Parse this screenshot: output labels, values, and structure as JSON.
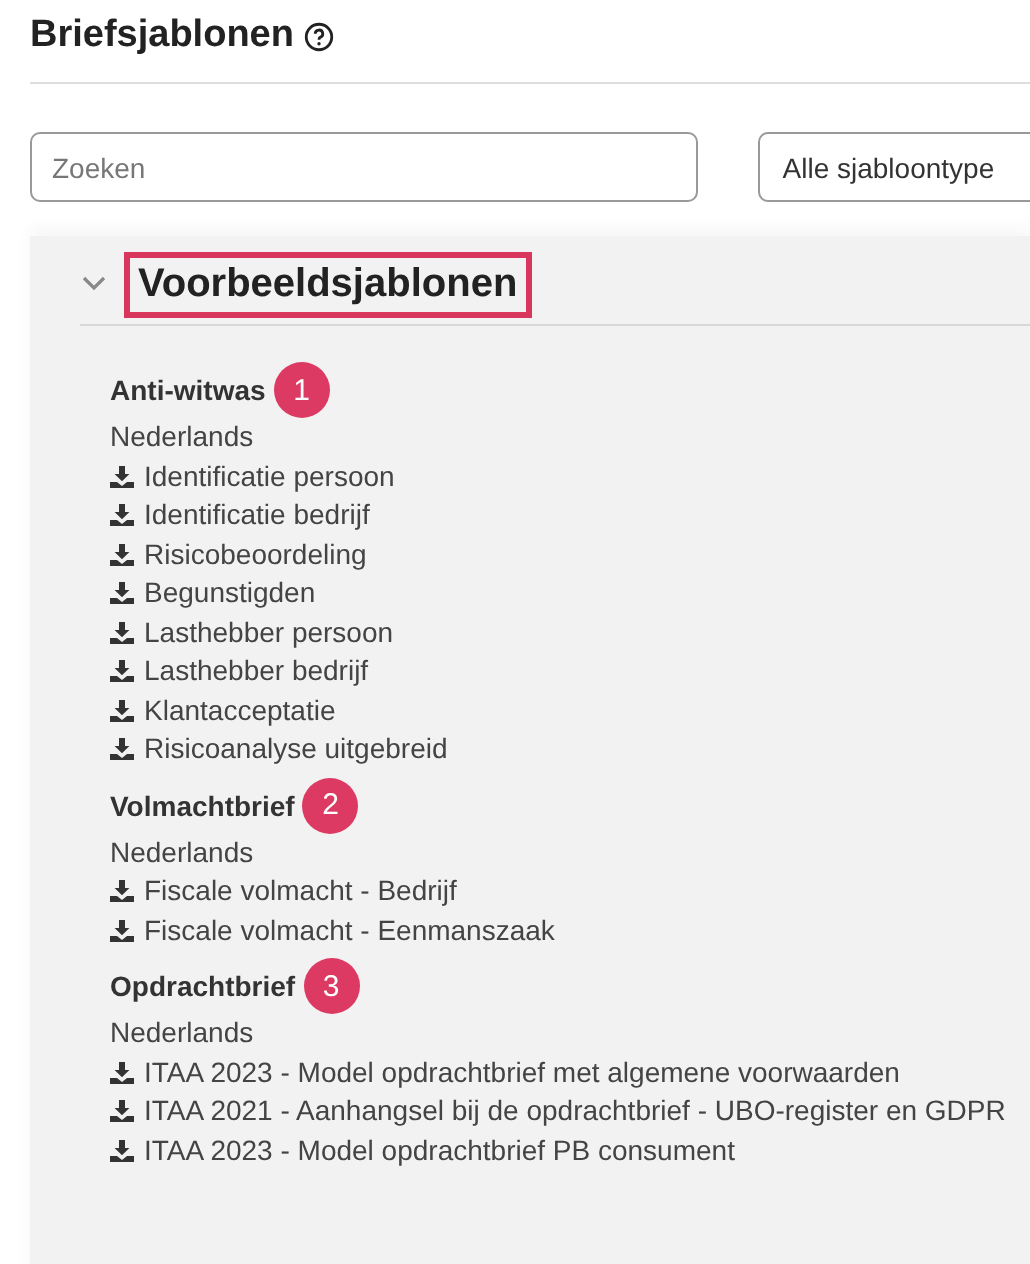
{
  "page": {
    "title": "Briefsjablonen"
  },
  "search": {
    "placeholder": "Zoeken"
  },
  "type_filter": {
    "value": "Alle sjabloontype"
  },
  "section": {
    "title": "Voorbeeldsjablonen",
    "expanded": true,
    "groups": [
      {
        "title": "Anti-witwas",
        "badge": "1",
        "language": "Nederlands",
        "templates": [
          "Identificatie persoon",
          "Identificatie bedrijf",
          "Risicobeoordeling",
          "Begunstigden",
          "Lasthebber persoon",
          "Lasthebber bedrijf",
          "Klantacceptatie",
          "Risicoanalyse uitgebreid"
        ]
      },
      {
        "title": "Volmachtbrief",
        "badge": "2",
        "language": "Nederlands",
        "templates": [
          "Fiscale volmacht - Bedrijf",
          "Fiscale volmacht - Eenmanszaak"
        ]
      },
      {
        "title": "Opdrachtbrief",
        "badge": "3",
        "language": "Nederlands",
        "templates": [
          "ITAA 2023 - Model opdrachtbrief met algemene voorwaarden",
          "ITAA 2021 - Aanhangsel bij de opdrachtbrief - UBO-register en GDPR",
          "ITAA 2023 - Model opdrachtbrief PB consument"
        ]
      }
    ]
  }
}
